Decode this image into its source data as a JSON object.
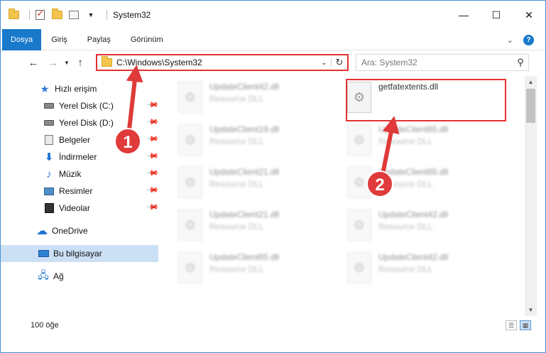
{
  "window": {
    "title": "System32",
    "controls": {
      "minimize": "—",
      "maximize": "☐",
      "close": "✕"
    }
  },
  "ribbon": {
    "tabs": [
      "Dosya",
      "Giriş",
      "Paylaş",
      "Görünüm"
    ],
    "expand_icon": "chevron-down-icon",
    "help_icon": "?"
  },
  "nav": {
    "address": "C:\\Windows\\System32",
    "search_placeholder": "Ara: System32"
  },
  "sidebar": {
    "items": [
      {
        "label": "Hızlı erişim",
        "icon": "star-icon",
        "pinned": false
      },
      {
        "label": "Yerel Disk (C:)",
        "icon": "drive-icon",
        "pinned": true
      },
      {
        "label": "Yerel Disk (D:)",
        "icon": "drive-icon",
        "pinned": true
      },
      {
        "label": "Belgeler",
        "icon": "documents-icon",
        "pinned": true
      },
      {
        "label": "İndirmeler",
        "icon": "download-icon",
        "pinned": true
      },
      {
        "label": "Müzik",
        "icon": "music-icon",
        "pinned": true
      },
      {
        "label": "Resimler",
        "icon": "pictures-icon",
        "pinned": true
      },
      {
        "label": "Videolar",
        "icon": "videos-icon",
        "pinned": true
      },
      {
        "label": "OneDrive",
        "icon": "cloud-icon",
        "pinned": false
      },
      {
        "label": "Bu bilgisayar",
        "icon": "computer-icon",
        "pinned": false,
        "selected": true
      },
      {
        "label": "Ağ",
        "icon": "network-icon",
        "pinned": false
      }
    ]
  },
  "files": [
    {
      "name": "UpdateClient42.dll",
      "type": "Resource DLL",
      "blurred": true
    },
    {
      "name": "getfatextents.dll",
      "type": "",
      "blurred": false,
      "highlighted": true
    },
    {
      "name": "UpdateClient19.dll",
      "type": "Resource DLL",
      "blurred": true
    },
    {
      "name": "UpdateClient65.dll",
      "type": "Resource DLL",
      "blurred": true
    },
    {
      "name": "UpdateClient21.dll",
      "type": "Resource DLL",
      "blurred": true
    },
    {
      "name": "UpdateClient65.dll",
      "type": "Resource DLL",
      "blurred": true
    },
    {
      "name": "UpdateClient21.dll",
      "type": "Resource DLL",
      "blurred": true
    },
    {
      "name": "UpdateClient42.dll",
      "type": "Resource DLL",
      "blurred": true
    },
    {
      "name": "UpdateClient65.dll",
      "type": "Resource DLL",
      "blurred": true
    },
    {
      "name": "UpdateClient42.dll",
      "type": "Resource DLL",
      "blurred": true
    }
  ],
  "status": {
    "count": "100 öğe"
  },
  "annotations": {
    "badge1": "1",
    "badge2": "2",
    "color": "#e03a3a"
  }
}
